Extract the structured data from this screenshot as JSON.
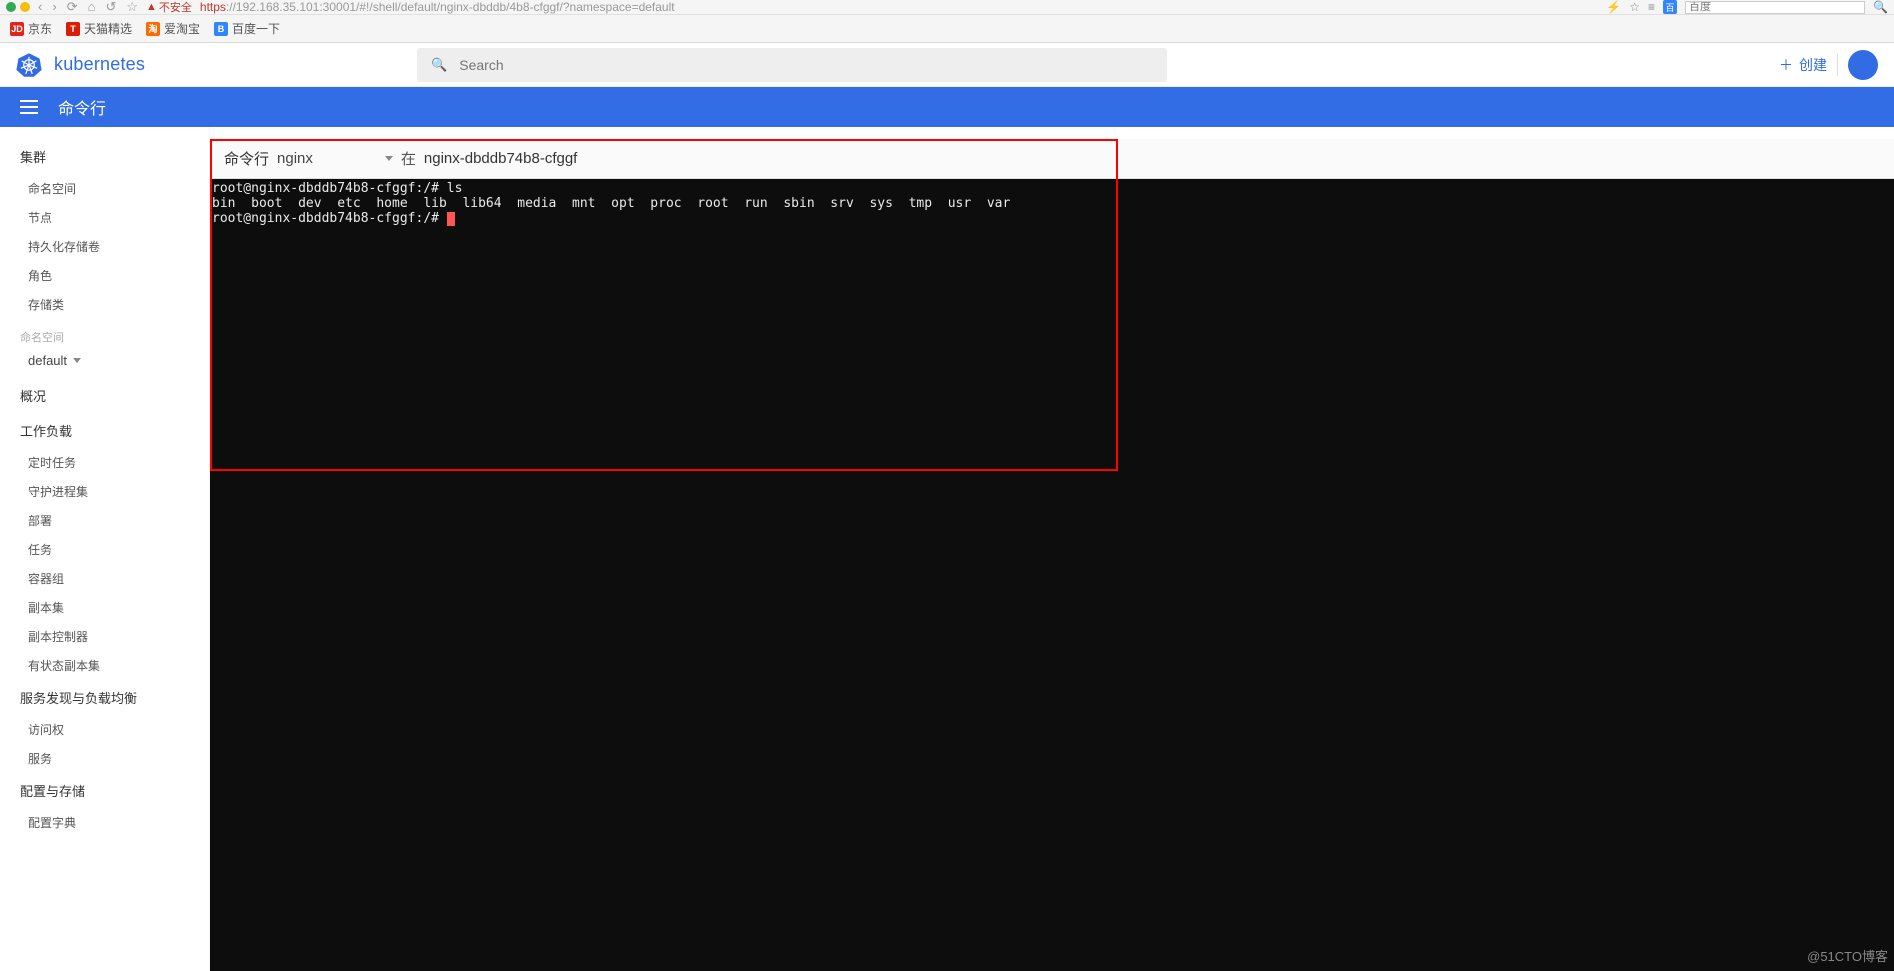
{
  "browser": {
    "insecure_label": "不安全",
    "url_proto": "https",
    "url_host": "://192.168.35.101",
    "url_path": ":30001/#!/shell/default/nginx-dbddb/4b8-cfggf/?namespace=default",
    "baidu_logo": "百",
    "baidu_placeholder": "百度",
    "icons": {
      "back": "‹",
      "fwd": "›",
      "reload": "⟳",
      "home": "⌂",
      "undo": "↺",
      "star": "☆",
      "bolt": "⚡",
      "star2": "☆",
      "menu": "≡"
    }
  },
  "bookmarks": [
    {
      "icon": "JD",
      "cls": "jd",
      "label": "京东"
    },
    {
      "icon": "T",
      "cls": "tm",
      "label": "天猫精选"
    },
    {
      "icon": "淘",
      "cls": "at",
      "label": "爱淘宝"
    },
    {
      "icon": "B",
      "cls": "bd",
      "label": "百度一下"
    }
  ],
  "header": {
    "title": "kubernetes",
    "search_placeholder": "Search",
    "create_label": "创建"
  },
  "bluebar": {
    "title": "命令行"
  },
  "sidebar": {
    "group_cluster": "集群",
    "cluster_items": [
      "命名空间",
      "节点",
      "持久化存储卷",
      "角色",
      "存储类"
    ],
    "namespace_head": "命名空间",
    "namespace_value": "default",
    "group_overview": "概况",
    "group_workloads": "工作负载",
    "workload_items": [
      "定时任务",
      "守护进程集",
      "部署",
      "任务",
      "容器组",
      "副本集",
      "副本控制器",
      "有状态副本集"
    ],
    "group_svc": "服务发现与负载均衡",
    "svc_items": [
      "访问权",
      "服务"
    ],
    "group_config": "配置与存储",
    "config_items": [
      "配置字典"
    ]
  },
  "shell": {
    "header_label": "命令行",
    "container": "nginx",
    "in_label": "在",
    "pod": "nginx-dbddb74b8-cfggf",
    "lines": [
      "root@nginx-dbddb74b8-cfggf:/# ls",
      "bin  boot  dev  etc  home  lib  lib64  media  mnt  opt  proc  root  run  sbin  srv  sys  tmp  usr  var",
      "root@nginx-dbddb74b8-cfggf:/# "
    ]
  },
  "watermark": "@51CTO博客"
}
